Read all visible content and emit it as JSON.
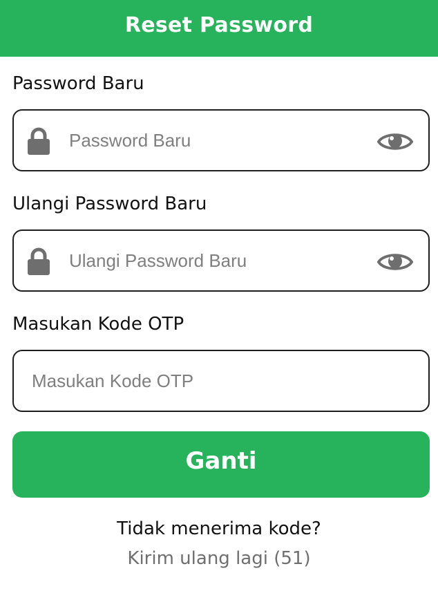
{
  "header": {
    "title": "Reset Password",
    "color": "#27b35b"
  },
  "fields": [
    {
      "label": "Password Baru",
      "placeholder": "Password Baru",
      "value": "",
      "leading_icon": "lock-icon",
      "trailing_icon": "eye-icon"
    },
    {
      "label": "Ulangi Password Baru",
      "placeholder": "Ulangi Password Baru",
      "value": "",
      "leading_icon": "lock-icon",
      "trailing_icon": "eye-icon"
    },
    {
      "label": "Masukan Kode OTP",
      "placeholder": "Masukan Kode OTP",
      "value": ""
    }
  ],
  "submit": {
    "label": "Ganti"
  },
  "footer": {
    "question": "Tidak menerima kode?",
    "resend_text": "Kirim ulang lagi",
    "countdown": "(51)"
  }
}
